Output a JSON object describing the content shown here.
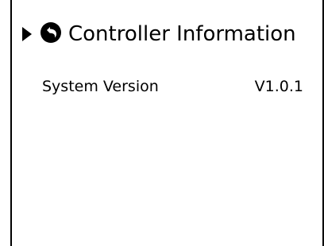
{
  "header": {
    "title": "Controller Information",
    "expand_icon": "triangle-right-icon",
    "back_icon": "back-arrow-circle-icon"
  },
  "info": {
    "rows": [
      {
        "label": "System Version",
        "value": "V1.0.1"
      }
    ]
  }
}
